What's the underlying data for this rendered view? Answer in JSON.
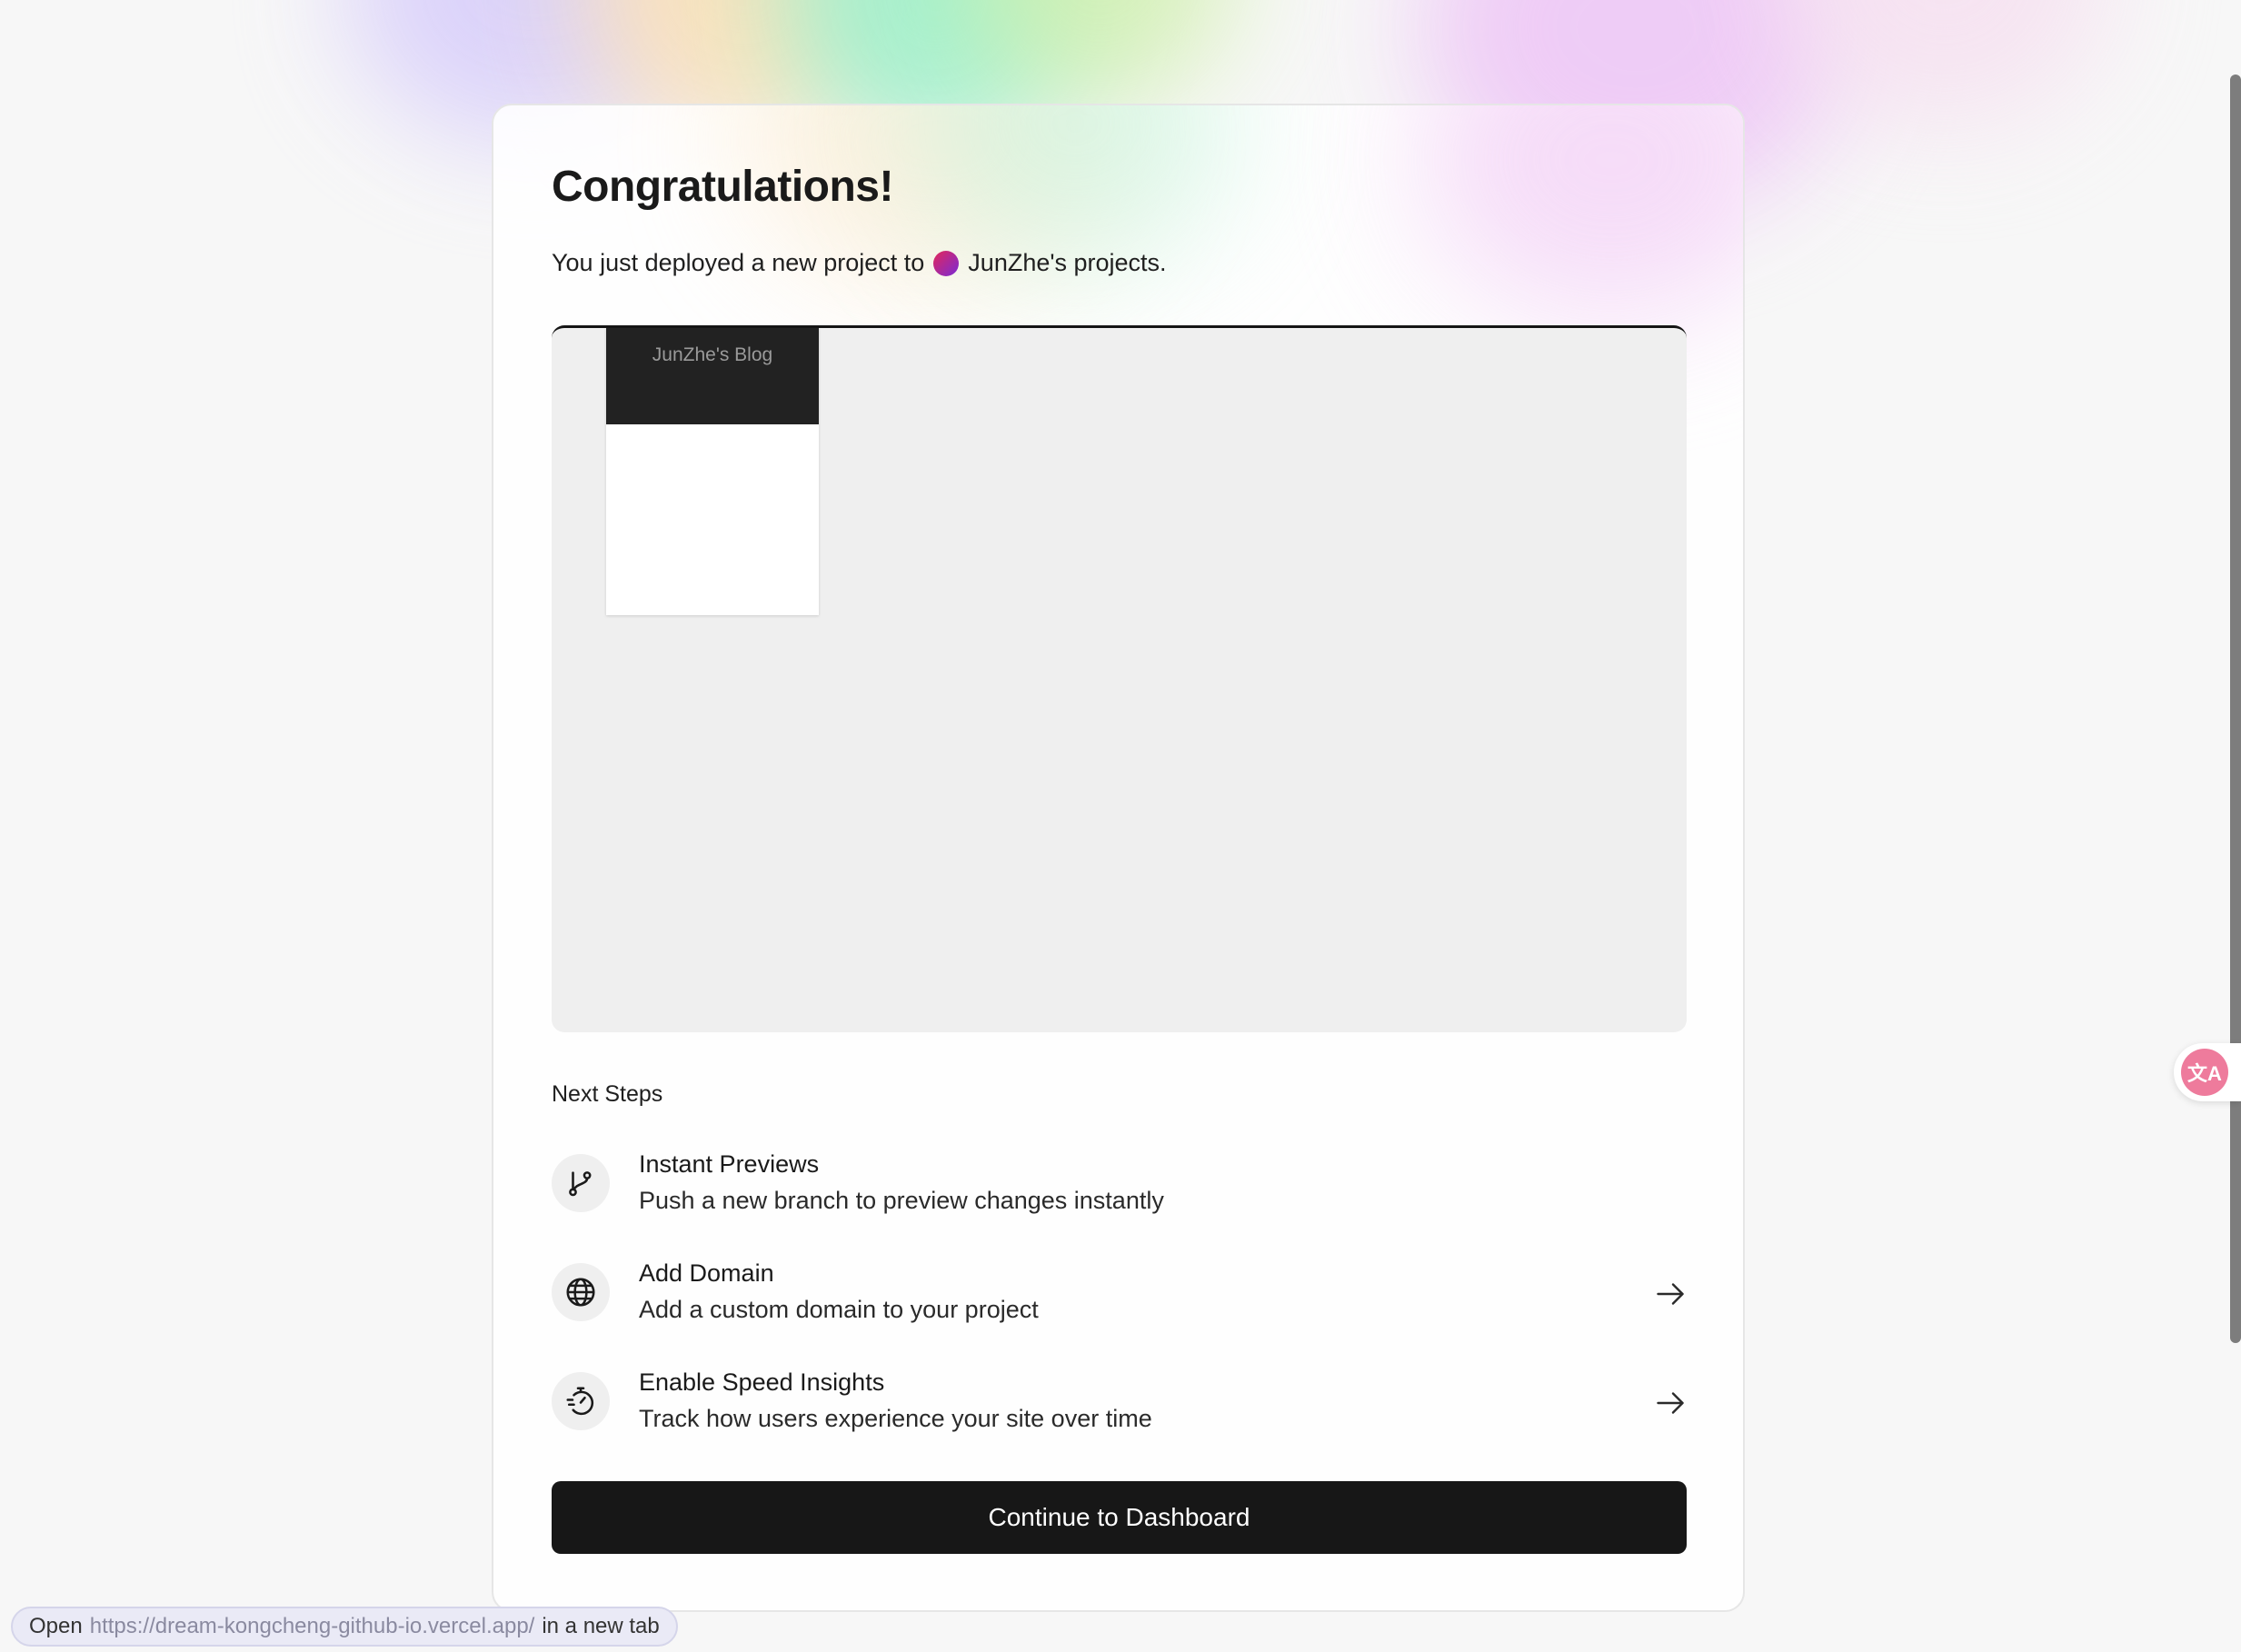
{
  "card": {
    "title": "Congratulations!",
    "subtitle_prefix": "You just deployed a new project to",
    "team_name": "JunZhe's projects."
  },
  "preview": {
    "site_title": "JunZhe's Blog"
  },
  "next_steps": {
    "label": "Next Steps",
    "items": [
      {
        "icon": "git-branch-icon",
        "title": "Instant Previews",
        "description": "Push a new branch to preview changes instantly"
      },
      {
        "icon": "globe-icon",
        "title": "Add Domain",
        "description": "Add a custom domain to your project"
      },
      {
        "icon": "speed-insights-icon",
        "title": "Enable Speed Insights",
        "description": "Track how users experience your site over time"
      }
    ]
  },
  "cta": {
    "label": "Continue to Dashboard"
  },
  "status_bar": {
    "open": "Open",
    "url": "https://dream-kongcheng-github-io.vercel.app/",
    "suffix": "in a new tab"
  },
  "translate_widget": {
    "glyph": "文A"
  },
  "colors": {
    "cta_bg": "#171717",
    "preview_bg": "#efefef",
    "team_avatar_start": "#e3275a",
    "team_avatar_end": "#7a2bd6"
  }
}
